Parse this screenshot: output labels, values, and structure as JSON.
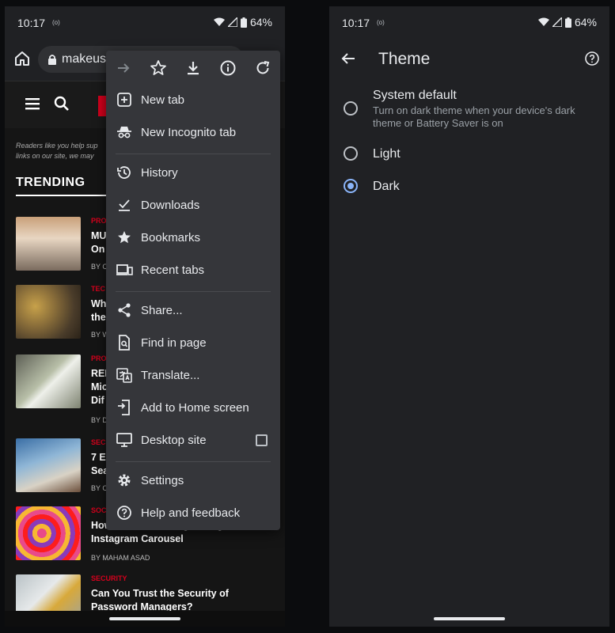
{
  "left_screen": {
    "status": {
      "time": "10:17",
      "battery": "64%"
    },
    "address_bar": {
      "url": "makeus"
    },
    "page": {
      "disclaimer_line1": "Readers like you help sup",
      "disclaimer_line2": "links on our site, we may",
      "trending_heading": "TRENDING",
      "articles": [
        {
          "category": "PRO",
          "title": "MU\nOn",
          "byline": "BY C"
        },
        {
          "category": "TEC",
          "title": "Wh\nthe",
          "byline": "BY W"
        },
        {
          "category": "PRO",
          "title": "REI\nMic\nDif",
          "byline": "BY D"
        },
        {
          "category": "SEC",
          "title": "7 E\nSea",
          "byline": "BY C"
        },
        {
          "category": "SOC",
          "title": "How to Delete a Single Image From an Instagram Carousel",
          "byline": "BY MAHAM ASAD"
        },
        {
          "category": "SECURITY",
          "title": "Can You Trust the Security of Password Managers?",
          "byline": ""
        }
      ]
    },
    "menu": {
      "top_icons": [
        "forward-icon",
        "star-icon",
        "download-icon",
        "info-icon",
        "refresh-icon"
      ],
      "items": [
        {
          "label": "New tab",
          "icon": "new-tab-icon"
        },
        {
          "label": "New Incognito tab",
          "icon": "incognito-icon"
        },
        {
          "label": "History",
          "icon": "history-icon"
        },
        {
          "label": "Downloads",
          "icon": "downloads-icon"
        },
        {
          "label": "Bookmarks",
          "icon": "bookmarks-icon"
        },
        {
          "label": "Recent tabs",
          "icon": "recent-tabs-icon"
        },
        {
          "label": "Share...",
          "icon": "share-icon"
        },
        {
          "label": "Find in page",
          "icon": "find-in-page-icon"
        },
        {
          "label": "Translate...",
          "icon": "translate-icon"
        },
        {
          "label": "Add to Home screen",
          "icon": "add-home-icon"
        },
        {
          "label": "Desktop site",
          "icon": "desktop-icon"
        },
        {
          "label": "Settings",
          "icon": "settings-icon"
        },
        {
          "label": "Help and feedback",
          "icon": "help-icon"
        }
      ],
      "desktop_site_checked": false
    }
  },
  "right_screen": {
    "status": {
      "time": "10:17",
      "battery": "64%"
    },
    "title": "Theme",
    "options": [
      {
        "label": "System default",
        "subtitle": "Turn on dark theme when your device's dark theme or Battery Saver is on",
        "selected": false
      },
      {
        "label": "Light",
        "subtitle": "",
        "selected": false
      },
      {
        "label": "Dark",
        "subtitle": "",
        "selected": true
      }
    ],
    "accent_color": "#8ab4f8"
  }
}
